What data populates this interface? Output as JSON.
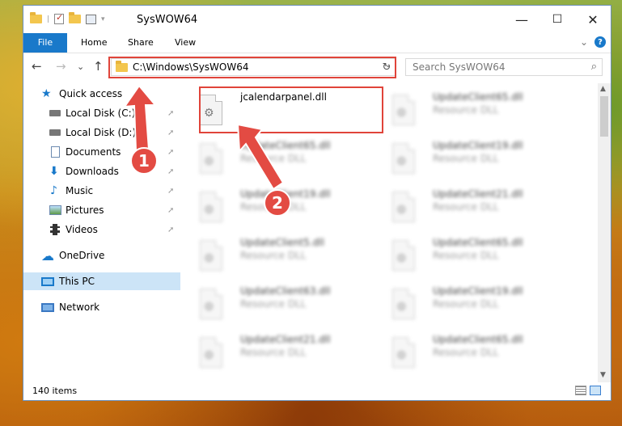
{
  "window": {
    "title": "SysWOW64",
    "minimize": "—",
    "maximize": "☐",
    "close": "✕"
  },
  "ribbon": {
    "tabs": [
      "File",
      "Home",
      "Share",
      "View"
    ],
    "expand": "⌄",
    "help": "?"
  },
  "navbar": {
    "back": "←",
    "forward": "→",
    "recent": "⌄",
    "up": "↑",
    "address": "C:\\Windows\\SysWOW64",
    "address_dropdown": "⌄",
    "refresh": "↻",
    "search_placeholder": "Search SysWOW64",
    "search_icon": "⌕"
  },
  "sidebar": {
    "items": [
      {
        "label": "Quick access",
        "icon": "star-icon"
      },
      {
        "label": "Local Disk (C:)",
        "icon": "disk-icon",
        "pinned": true
      },
      {
        "label": "Local Disk (D:)",
        "icon": "disk-icon",
        "pinned": true
      },
      {
        "label": "Documents",
        "icon": "documents-icon",
        "pinned": true
      },
      {
        "label": "Downloads",
        "icon": "downloads-icon",
        "pinned": true
      },
      {
        "label": "Music",
        "icon": "music-icon",
        "pinned": true
      },
      {
        "label": "Pictures",
        "icon": "pictures-icon",
        "pinned": true
      },
      {
        "label": "Videos",
        "icon": "videos-icon",
        "pinned": true
      },
      {
        "label": "OneDrive",
        "icon": "onedrive-icon"
      },
      {
        "label": "This PC",
        "icon": "this-pc-icon",
        "selected": true
      },
      {
        "label": "Network",
        "icon": "network-icon"
      }
    ],
    "pin_glyph": "📌"
  },
  "files": [
    {
      "name": "jcalendarpanel.dll",
      "type": ""
    },
    {
      "name": "UpdateClient65.dll",
      "type": "Resource DLL"
    },
    {
      "name": "UpdateClient65.dll",
      "type": "Resource DLL"
    },
    {
      "name": "UpdateClient19.dll",
      "type": "Resource DLL"
    },
    {
      "name": "UpdateClient19.dll",
      "type": "Resource DLL"
    },
    {
      "name": "UpdateClient21.dll",
      "type": "Resource DLL"
    },
    {
      "name": "UpdateClient5.dll",
      "type": "Resource DLL"
    },
    {
      "name": "UpdateClient65.dll",
      "type": "Resource DLL"
    },
    {
      "name": "UpdateClient63.dll",
      "type": "Resource DLL"
    },
    {
      "name": "UpdateClient19.dll",
      "type": "Resource DLL"
    },
    {
      "name": "UpdateClient21.dll",
      "type": "Resource DLL"
    },
    {
      "name": "UpdateClient65.dll",
      "type": "Resource DLL"
    }
  ],
  "status": {
    "count": "140 items"
  },
  "annotations": {
    "marker1": "1",
    "marker2": "2"
  },
  "colors": {
    "accent": "#1979ca",
    "highlight": "#e0443a",
    "marker": "#e34b43"
  }
}
